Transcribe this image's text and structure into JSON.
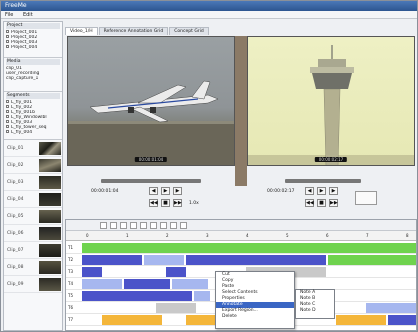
{
  "window": {
    "title": "FreeMe"
  },
  "menu": [
    "File",
    "Edit"
  ],
  "left_panels": {
    "project_header": "Project",
    "projects": [
      "Project_001",
      "Project_002",
      "Project_003",
      "Project_004"
    ],
    "media_header": "Media",
    "media": [
      "clip_01",
      "user_recording",
      "clip_capture_1"
    ],
    "segments_header": "Segments",
    "segments": [
      "L_fly_001",
      "L_fly_002",
      "L_fly_001b",
      "L_fly_Windowlbl",
      "L_fly_003",
      "L_fly_tower_seq",
      "L_fly_004"
    ],
    "thumb_labels": [
      "Clip_01",
      "Clip_02",
      "Clip_03",
      "Clip_04",
      "Clip_05",
      "Clip_06",
      "Clip_07",
      "Clip_08",
      "Clip_09"
    ]
  },
  "tabs": [
    {
      "label": "Video_1/H",
      "active": true
    },
    {
      "label": "Reference Annotation Grid",
      "active": false
    },
    {
      "label": "Concept Grid",
      "active": false
    }
  ],
  "video_left": {
    "caption": "00:00:01:04"
  },
  "video_right": {
    "caption": "00:00:02:17"
  },
  "controls_left": {
    "timecode": "00:00:01:04",
    "speed": "1.0x"
  },
  "controls_right": {
    "timecode": "00:00:02:17"
  },
  "timeline": {
    "ruler": [
      "0",
      "1",
      "2",
      "3",
      "4",
      "5",
      "6",
      "7",
      "8"
    ],
    "track_labels": [
      "T1",
      "T2",
      "T3",
      "T4",
      "T5",
      "T6",
      "T7",
      "T8"
    ]
  },
  "context_menu": {
    "items": [
      "Cut",
      "Copy",
      "Paste",
      "Select Contents",
      "Properties",
      "Annotate",
      "Export Region...",
      "Delete"
    ],
    "submenu": [
      "Note A",
      "Note B",
      "Note C",
      "Note D"
    ]
  },
  "colors": {
    "green": "#6fd34e",
    "blue": "#4b53c9",
    "lightblue": "#a6b7ef",
    "orange": "#f4b63a",
    "gray": "#c9c9c9"
  }
}
